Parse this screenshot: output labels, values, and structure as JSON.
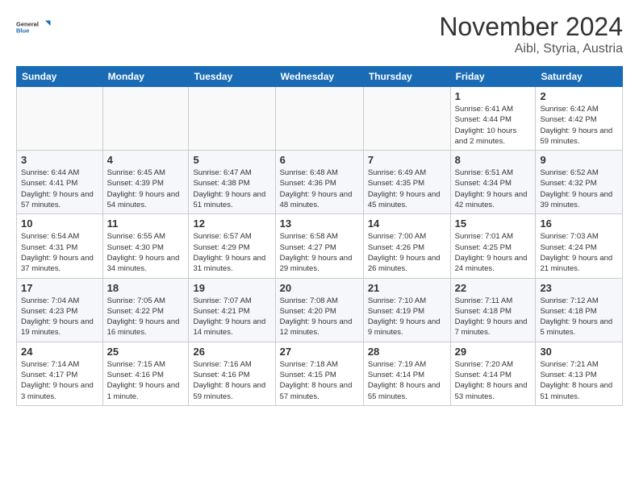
{
  "header": {
    "logo": {
      "line1": "General",
      "line2": "Blue"
    },
    "title": "November 2024",
    "subtitle": "Aibl, Styria, Austria"
  },
  "calendar": {
    "headers": [
      "Sunday",
      "Monday",
      "Tuesday",
      "Wednesday",
      "Thursday",
      "Friday",
      "Saturday"
    ],
    "weeks": [
      [
        {
          "day": "",
          "info": ""
        },
        {
          "day": "",
          "info": ""
        },
        {
          "day": "",
          "info": ""
        },
        {
          "day": "",
          "info": ""
        },
        {
          "day": "",
          "info": ""
        },
        {
          "day": "1",
          "info": "Sunrise: 6:41 AM\nSunset: 4:44 PM\nDaylight: 10 hours\nand 2 minutes."
        },
        {
          "day": "2",
          "info": "Sunrise: 6:42 AM\nSunset: 4:42 PM\nDaylight: 9 hours\nand 59 minutes."
        }
      ],
      [
        {
          "day": "3",
          "info": "Sunrise: 6:44 AM\nSunset: 4:41 PM\nDaylight: 9 hours\nand 57 minutes."
        },
        {
          "day": "4",
          "info": "Sunrise: 6:45 AM\nSunset: 4:39 PM\nDaylight: 9 hours\nand 54 minutes."
        },
        {
          "day": "5",
          "info": "Sunrise: 6:47 AM\nSunset: 4:38 PM\nDaylight: 9 hours\nand 51 minutes."
        },
        {
          "day": "6",
          "info": "Sunrise: 6:48 AM\nSunset: 4:36 PM\nDaylight: 9 hours\nand 48 minutes."
        },
        {
          "day": "7",
          "info": "Sunrise: 6:49 AM\nSunset: 4:35 PM\nDaylight: 9 hours\nand 45 minutes."
        },
        {
          "day": "8",
          "info": "Sunrise: 6:51 AM\nSunset: 4:34 PM\nDaylight: 9 hours\nand 42 minutes."
        },
        {
          "day": "9",
          "info": "Sunrise: 6:52 AM\nSunset: 4:32 PM\nDaylight: 9 hours\nand 39 minutes."
        }
      ],
      [
        {
          "day": "10",
          "info": "Sunrise: 6:54 AM\nSunset: 4:31 PM\nDaylight: 9 hours\nand 37 minutes."
        },
        {
          "day": "11",
          "info": "Sunrise: 6:55 AM\nSunset: 4:30 PM\nDaylight: 9 hours\nand 34 minutes."
        },
        {
          "day": "12",
          "info": "Sunrise: 6:57 AM\nSunset: 4:29 PM\nDaylight: 9 hours\nand 31 minutes."
        },
        {
          "day": "13",
          "info": "Sunrise: 6:58 AM\nSunset: 4:27 PM\nDaylight: 9 hours\nand 29 minutes."
        },
        {
          "day": "14",
          "info": "Sunrise: 7:00 AM\nSunset: 4:26 PM\nDaylight: 9 hours\nand 26 minutes."
        },
        {
          "day": "15",
          "info": "Sunrise: 7:01 AM\nSunset: 4:25 PM\nDaylight: 9 hours\nand 24 minutes."
        },
        {
          "day": "16",
          "info": "Sunrise: 7:03 AM\nSunset: 4:24 PM\nDaylight: 9 hours\nand 21 minutes."
        }
      ],
      [
        {
          "day": "17",
          "info": "Sunrise: 7:04 AM\nSunset: 4:23 PM\nDaylight: 9 hours\nand 19 minutes."
        },
        {
          "day": "18",
          "info": "Sunrise: 7:05 AM\nSunset: 4:22 PM\nDaylight: 9 hours\nand 16 minutes."
        },
        {
          "day": "19",
          "info": "Sunrise: 7:07 AM\nSunset: 4:21 PM\nDaylight: 9 hours\nand 14 minutes."
        },
        {
          "day": "20",
          "info": "Sunrise: 7:08 AM\nSunset: 4:20 PM\nDaylight: 9 hours\nand 12 minutes."
        },
        {
          "day": "21",
          "info": "Sunrise: 7:10 AM\nSunset: 4:19 PM\nDaylight: 9 hours\nand 9 minutes."
        },
        {
          "day": "22",
          "info": "Sunrise: 7:11 AM\nSunset: 4:18 PM\nDaylight: 9 hours\nand 7 minutes."
        },
        {
          "day": "23",
          "info": "Sunrise: 7:12 AM\nSunset: 4:18 PM\nDaylight: 9 hours\nand 5 minutes."
        }
      ],
      [
        {
          "day": "24",
          "info": "Sunrise: 7:14 AM\nSunset: 4:17 PM\nDaylight: 9 hours\nand 3 minutes."
        },
        {
          "day": "25",
          "info": "Sunrise: 7:15 AM\nSunset: 4:16 PM\nDaylight: 9 hours\nand 1 minute."
        },
        {
          "day": "26",
          "info": "Sunrise: 7:16 AM\nSunset: 4:16 PM\nDaylight: 8 hours\nand 59 minutes."
        },
        {
          "day": "27",
          "info": "Sunrise: 7:18 AM\nSunset: 4:15 PM\nDaylight: 8 hours\nand 57 minutes."
        },
        {
          "day": "28",
          "info": "Sunrise: 7:19 AM\nSunset: 4:14 PM\nDaylight: 8 hours\nand 55 minutes."
        },
        {
          "day": "29",
          "info": "Sunrise: 7:20 AM\nSunset: 4:14 PM\nDaylight: 8 hours\nand 53 minutes."
        },
        {
          "day": "30",
          "info": "Sunrise: 7:21 AM\nSunset: 4:13 PM\nDaylight: 8 hours\nand 51 minutes."
        }
      ]
    ]
  }
}
